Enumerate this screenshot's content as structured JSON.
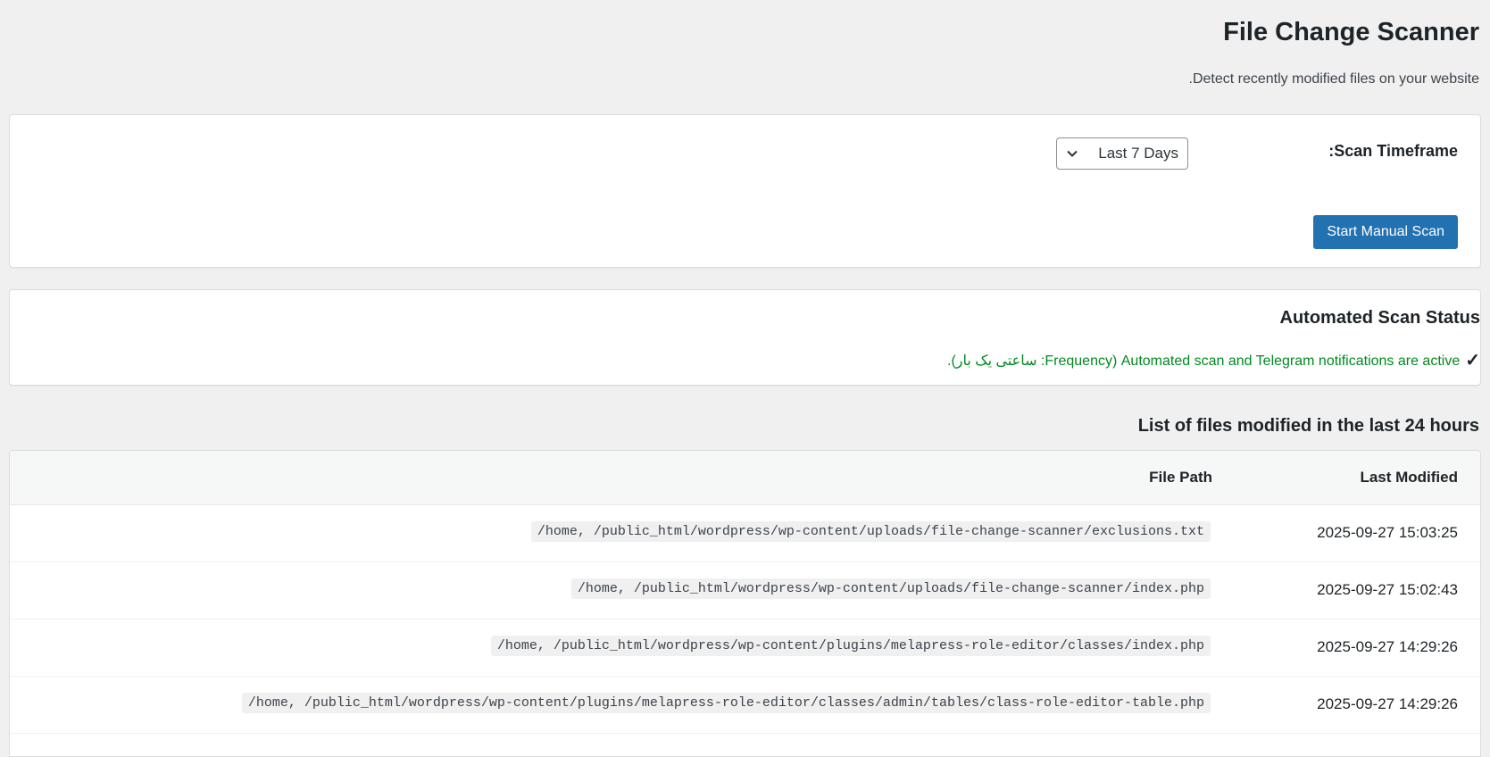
{
  "header": {
    "title": "File Change Scanner",
    "subtitle": "Detect recently modified files on your website."
  },
  "scan": {
    "timeframe_label": "Scan Timeframe:",
    "timeframe_value": "Last 7 Days",
    "start_button": "Start Manual Scan"
  },
  "status": {
    "title": "Automated Scan Status",
    "check_icon": "✓",
    "message": "Automated scan and Telegram notifications are active (Frequency: ساعتی یک بار).",
    "color": "#008a20"
  },
  "list": {
    "title": "List of files modified in the last 24 hours",
    "columns": [
      "Last Modified",
      "File Path"
    ],
    "rows": [
      {
        "date": "2025-09-27 15:03:25",
        "path": "/home,          /public_html/wordpress/wp-content/uploads/file-change-scanner/exclusions.txt"
      },
      {
        "date": "2025-09-27 15:02:43",
        "path": "/home,          /public_html/wordpress/wp-content/uploads/file-change-scanner/index.php"
      },
      {
        "date": "2025-09-27 14:29:26",
        "path": "/home,          /public_html/wordpress/wp-content/plugins/melapress-role-editor/classes/index.php"
      },
      {
        "date": "2025-09-27 14:29:26",
        "path": "/home,          /public_html/wordpress/wp-content/plugins/melapress-role-editor/classes/admin/tables/class-role-editor-table.php"
      }
    ]
  },
  "colors": {
    "primary_button": "#2271b1",
    "background": "#f0f0f1"
  }
}
